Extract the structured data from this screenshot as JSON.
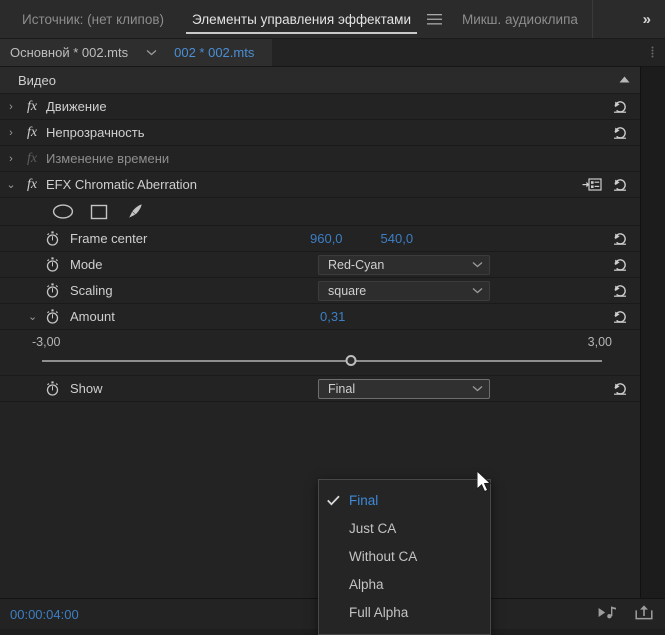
{
  "panel_header": {
    "source_tab": "Источник: (нет клипов)",
    "active_tab": "Элементы управления эффектами",
    "menu_icon": "hamburger-menu-icon",
    "audio_mixer_tab": "Микш. аудиоклипа",
    "overflow_label": "»"
  },
  "clip_strip": {
    "master_tab": "Основной * 002.mts",
    "caret": "chevron-down-icon",
    "sequence_tab": "002 * 002.mts"
  },
  "video_section": {
    "title": "Видео",
    "collapse_icon": "triangle-up-icon"
  },
  "effects": [
    {
      "name": "Движение",
      "twisty": "›",
      "enabled": true,
      "reset": "reset-icon"
    },
    {
      "name": "Непрозрачность",
      "twisty": "›",
      "enabled": true,
      "reset": "reset-icon"
    },
    {
      "name": "Изменение времени",
      "twisty": "›",
      "enabled": false,
      "reset": ""
    },
    {
      "name": "EFX Chromatic Aberration",
      "twisty": "⌄",
      "enabled": true,
      "reset": "reset-icon",
      "freeform": "free-form-view-icon"
    }
  ],
  "shape_tools": [
    {
      "name": "ellipse-mask-tool"
    },
    {
      "name": "rectangle-mask-tool"
    },
    {
      "name": "pen-mask-tool"
    }
  ],
  "parameters": {
    "frame_center": {
      "label": "Frame center",
      "x_value": "960,0",
      "y_value": "540,0"
    },
    "mode": {
      "label": "Mode",
      "value": "Red-Cyan"
    },
    "scaling": {
      "label": "Scaling",
      "value": "square"
    },
    "amount": {
      "label": "Amount",
      "value": "0,31",
      "min_label": "-3,00",
      "max_label": "3,00",
      "min": -3.0,
      "max": 3.0,
      "current": 0.31,
      "knob_percent": 55.2
    },
    "show": {
      "label": "Show",
      "value": "Final"
    }
  },
  "dropdown": {
    "open": true,
    "selected": "Final",
    "options": [
      {
        "label": "Final",
        "checked": true
      },
      {
        "label": "Just CA",
        "checked": false
      },
      {
        "label": "Without CA",
        "checked": false
      },
      {
        "label": "Alpha",
        "checked": false
      },
      {
        "label": "Full Alpha",
        "checked": false
      }
    ]
  },
  "footer": {
    "timecode": "00:00:04:00",
    "icons": [
      "play-audio-icon",
      "export-frame-icon"
    ]
  },
  "colors": {
    "accent_blue": "#3d7fc4",
    "panel_bg": "#232323",
    "header_bg": "#2b2b2b",
    "text": "#cfcfcf"
  }
}
